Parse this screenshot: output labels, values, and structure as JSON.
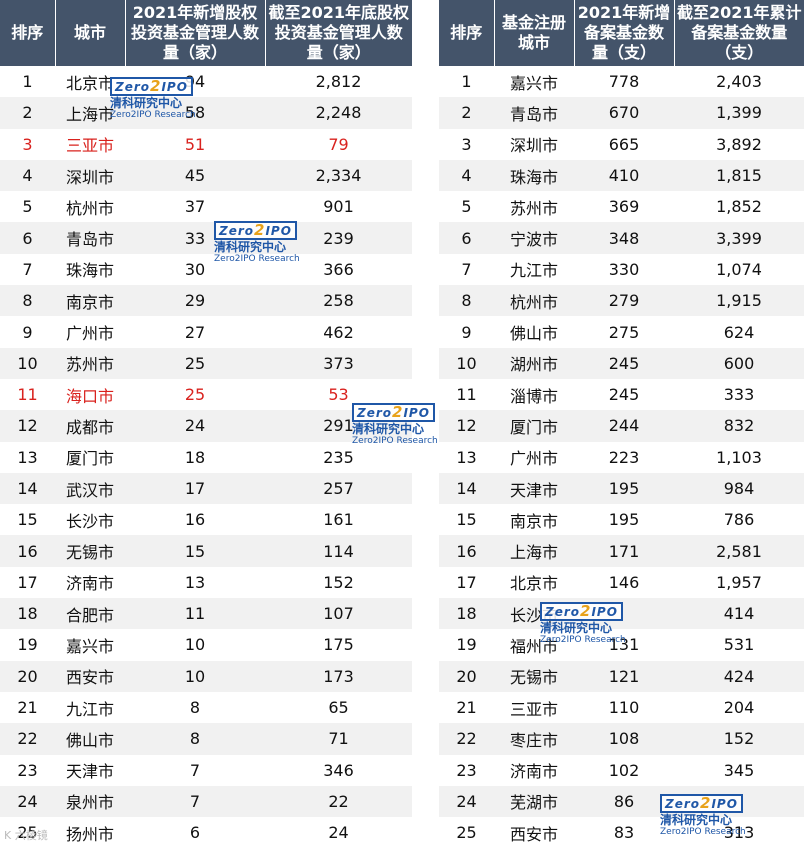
{
  "left_table": {
    "headers": [
      "排序",
      "城市",
      "2021年新增股权投资基金管理人数量（家）",
      "截至2021年底股权投资基金管理人数量（家）"
    ],
    "rows": [
      {
        "rank": "1",
        "city": "北京市",
        "new": "94",
        "total": "2,812",
        "highlight": false
      },
      {
        "rank": "2",
        "city": "上海市",
        "new": "58",
        "total": "2,248",
        "highlight": false
      },
      {
        "rank": "3",
        "city": "三亚市",
        "new": "51",
        "total": "79",
        "highlight": true
      },
      {
        "rank": "4",
        "city": "深圳市",
        "new": "45",
        "total": "2,334",
        "highlight": false
      },
      {
        "rank": "5",
        "city": "杭州市",
        "new": "37",
        "total": "901",
        "highlight": false
      },
      {
        "rank": "6",
        "city": "青岛市",
        "new": "33",
        "total": "239",
        "highlight": false
      },
      {
        "rank": "7",
        "city": "珠海市",
        "new": "30",
        "total": "366",
        "highlight": false
      },
      {
        "rank": "8",
        "city": "南京市",
        "new": "29",
        "total": "258",
        "highlight": false
      },
      {
        "rank": "9",
        "city": "广州市",
        "new": "27",
        "total": "462",
        "highlight": false
      },
      {
        "rank": "10",
        "city": "苏州市",
        "new": "25",
        "total": "373",
        "highlight": false
      },
      {
        "rank": "11",
        "city": "海口市",
        "new": "25",
        "total": "53",
        "highlight": true
      },
      {
        "rank": "12",
        "city": "成都市",
        "new": "24",
        "total": "291",
        "highlight": false
      },
      {
        "rank": "13",
        "city": "厦门市",
        "new": "18",
        "total": "235",
        "highlight": false
      },
      {
        "rank": "14",
        "city": "武汉市",
        "new": "17",
        "total": "257",
        "highlight": false
      },
      {
        "rank": "15",
        "city": "长沙市",
        "new": "16",
        "total": "161",
        "highlight": false
      },
      {
        "rank": "16",
        "city": "无锡市",
        "new": "15",
        "total": "114",
        "highlight": false
      },
      {
        "rank": "17",
        "city": "济南市",
        "new": "13",
        "total": "152",
        "highlight": false
      },
      {
        "rank": "18",
        "city": "合肥市",
        "new": "11",
        "total": "107",
        "highlight": false
      },
      {
        "rank": "19",
        "city": "嘉兴市",
        "new": "10",
        "total": "175",
        "highlight": false
      },
      {
        "rank": "20",
        "city": "西安市",
        "new": "10",
        "total": "173",
        "highlight": false
      },
      {
        "rank": "21",
        "city": "九江市",
        "new": "8",
        "total": "65",
        "highlight": false
      },
      {
        "rank": "22",
        "city": "佛山市",
        "new": "8",
        "total": "71",
        "highlight": false
      },
      {
        "rank": "23",
        "city": "天津市",
        "new": "7",
        "total": "346",
        "highlight": false
      },
      {
        "rank": "24",
        "city": "泉州市",
        "new": "7",
        "total": "22",
        "highlight": false
      },
      {
        "rank": "25",
        "city": "扬州市",
        "new": "6",
        "total": "24",
        "highlight": false
      }
    ]
  },
  "right_table": {
    "headers": [
      "排序",
      "基金注册城市",
      "2021年新增备案基金数量（支）",
      "截至2021年累计备案基金数量（支）"
    ],
    "rows": [
      {
        "rank": "1",
        "city": "嘉兴市",
        "new": "778",
        "total": "2,403",
        "highlight": false
      },
      {
        "rank": "2",
        "city": "青岛市",
        "new": "670",
        "total": "1,399",
        "highlight": false
      },
      {
        "rank": "3",
        "city": "深圳市",
        "new": "665",
        "total": "3,892",
        "highlight": false
      },
      {
        "rank": "4",
        "city": "珠海市",
        "new": "410",
        "total": "1,815",
        "highlight": false
      },
      {
        "rank": "5",
        "city": "苏州市",
        "new": "369",
        "total": "1,852",
        "highlight": false
      },
      {
        "rank": "6",
        "city": "宁波市",
        "new": "348",
        "total": "3,399",
        "highlight": false
      },
      {
        "rank": "7",
        "city": "九江市",
        "new": "330",
        "total": "1,074",
        "highlight": false
      },
      {
        "rank": "8",
        "city": "杭州市",
        "new": "279",
        "total": "1,915",
        "highlight": false
      },
      {
        "rank": "9",
        "city": "佛山市",
        "new": "275",
        "total": "624",
        "highlight": false
      },
      {
        "rank": "10",
        "city": "湖州市",
        "new": "245",
        "total": "600",
        "highlight": false
      },
      {
        "rank": "11",
        "city": "淄博市",
        "new": "245",
        "total": "333",
        "highlight": false
      },
      {
        "rank": "12",
        "city": "厦门市",
        "new": "244",
        "total": "832",
        "highlight": false
      },
      {
        "rank": "13",
        "city": "广州市",
        "new": "223",
        "total": "1,103",
        "highlight": false
      },
      {
        "rank": "14",
        "city": "天津市",
        "new": "195",
        "total": "984",
        "highlight": false
      },
      {
        "rank": "15",
        "city": "南京市",
        "new": "195",
        "total": "786",
        "highlight": false
      },
      {
        "rank": "16",
        "city": "上海市",
        "new": "171",
        "total": "2,581",
        "highlight": false
      },
      {
        "rank": "17",
        "city": "北京市",
        "new": "146",
        "total": "1,957",
        "highlight": false
      },
      {
        "rank": "18",
        "city": "长沙市",
        "new": "",
        "total": "414",
        "highlight": false
      },
      {
        "rank": "19",
        "city": "福州市",
        "new": "131",
        "total": "531",
        "highlight": false
      },
      {
        "rank": "20",
        "city": "无锡市",
        "new": "121",
        "total": "424",
        "highlight": false
      },
      {
        "rank": "21",
        "city": "三亚市",
        "new": "110",
        "total": "204",
        "highlight": false
      },
      {
        "rank": "22",
        "city": "枣庄市",
        "new": "108",
        "total": "152",
        "highlight": false
      },
      {
        "rank": "23",
        "city": "济南市",
        "new": "102",
        "total": "345",
        "highlight": false
      },
      {
        "rank": "24",
        "city": "芜湖市",
        "new": "86",
        "total": "",
        "highlight": false
      },
      {
        "rank": "25",
        "city": "西安市",
        "new": "83",
        "total": "313",
        "highlight": false
      }
    ]
  },
  "watermark": {
    "logo_a": "Zero",
    "logo_b": "2",
    "logo_c": "IPO",
    "cn": "清科研究中心",
    "en": "Zero2IPO Research"
  },
  "corner_mark": "K 六棱镜",
  "colors": {
    "header_bg": "#44546a",
    "highlight_text": "#d9221e",
    "stripe": "#f1f1f1",
    "brand": "#1f57a7"
  }
}
